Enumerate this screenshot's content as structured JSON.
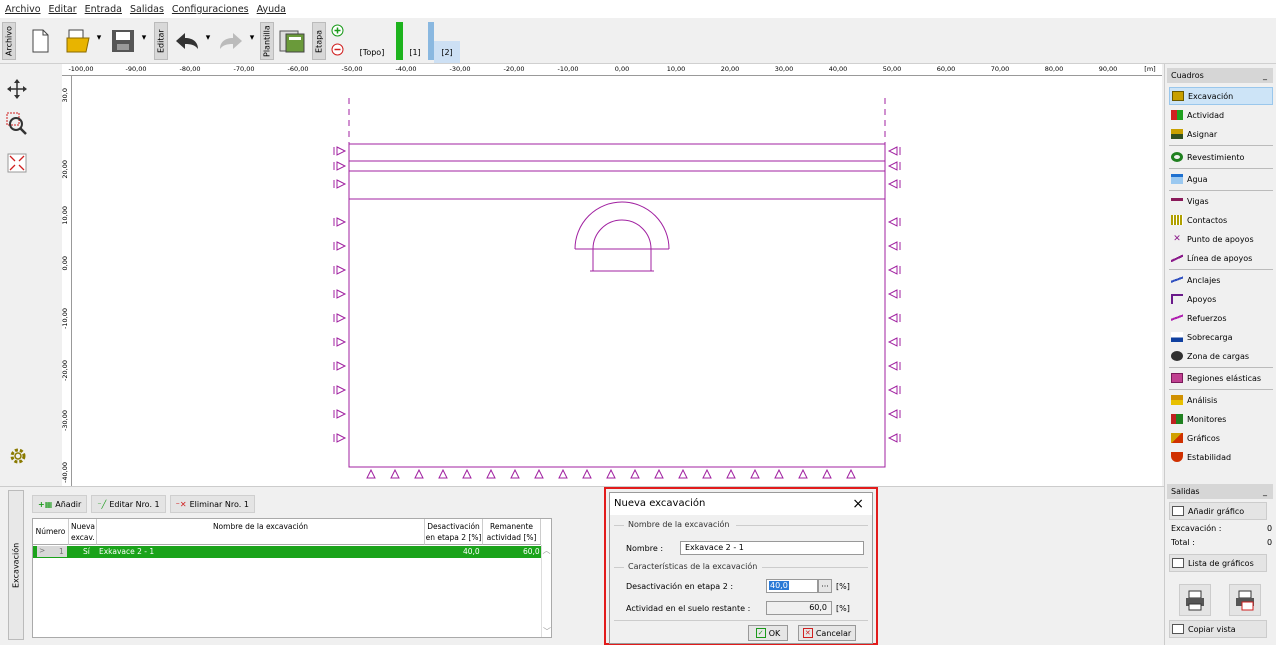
{
  "menu": [
    "Archivo",
    "Editar",
    "Entrada",
    "Salidas",
    "Configuraciones",
    "Ayuda"
  ],
  "toolbar": {
    "archivo_label": "Archivo",
    "editar_label": "Editar",
    "plantilla_label": "Plantilla",
    "etapa_label": "Etapa",
    "stage_topo": "[Topo]",
    "stage_1": "[1]",
    "stage_2": "[2]"
  },
  "ruler": {
    "unit": "[m]",
    "ticks": [
      "-100,00",
      "-90,00",
      "-80,00",
      "-70,00",
      "-60,00",
      "-50,00",
      "-40,00",
      "-30,00",
      "-20,00",
      "-10,00",
      "0,00",
      "10,00",
      "20,00",
      "30,00",
      "40,00",
      "50,00",
      "60,00",
      "70,00",
      "80,00",
      "90,00"
    ],
    "vticks": [
      "30,0",
      "20,00",
      "10,00",
      "0,00",
      "-10,00",
      "-20,00",
      "-30,00",
      "-40,00"
    ]
  },
  "cuadros": {
    "title": "Cuadros",
    "items": [
      {
        "label": "Excavación",
        "icon": "excavation-icon",
        "color": "#c8a000"
      },
      {
        "label": "Actividad",
        "icon": "activity-icon",
        "color": "#d02020"
      },
      {
        "label": "Asignar",
        "icon": "assign-icon",
        "color": "#a08000"
      },
      {
        "label": "Revestimiento",
        "icon": "lining-icon",
        "color": "#208020"
      },
      {
        "label": "Agua",
        "icon": "water-icon",
        "color": "#1e70d0"
      },
      {
        "label": "Vigas",
        "icon": "beams-icon",
        "color": "#8a1a5a"
      },
      {
        "label": "Contactos",
        "icon": "contacts-icon",
        "color": "#b0a000"
      },
      {
        "label": "Punto de apoyos",
        "icon": "point-support-icon",
        "color": "#8a1a8a"
      },
      {
        "label": "Línea de apoyos",
        "icon": "line-support-icon",
        "color": "#8a1a8a"
      },
      {
        "label": "Anclajes",
        "icon": "anchors-icon",
        "color": "#3050c0"
      },
      {
        "label": "Apoyos",
        "icon": "props-icon",
        "color": "#6a1a8a"
      },
      {
        "label": "Refuerzos",
        "icon": "reinforcement-icon",
        "color": "#b020b0"
      },
      {
        "label": "Sobrecarga",
        "icon": "surcharge-icon",
        "color": "#1040a0"
      },
      {
        "label": "Zona de cargas",
        "icon": "load-zone-icon",
        "color": "#303030"
      },
      {
        "label": "Regiones elásticas",
        "icon": "elastic-regions-icon",
        "color": "#c04090"
      },
      {
        "label": "Análisis",
        "icon": "analysis-icon",
        "color": "#d09000"
      },
      {
        "label": "Monitores",
        "icon": "monitors-icon",
        "color": "#c02020"
      },
      {
        "label": "Gráficos",
        "icon": "graphs-icon",
        "color": "#d0a000"
      },
      {
        "label": "Estabilidad",
        "icon": "stability-icon",
        "color": "#d03000"
      }
    ]
  },
  "salidas": {
    "title": "Salidas",
    "add_graph": "Añadir gráfico",
    "excavacion_label": "Excavación :",
    "excavacion_count": "0",
    "total_label": "Total :",
    "total_count": "0",
    "list_graphs": "Lista de gráficos",
    "copy_view": "Copiar vista"
  },
  "bottom": {
    "side_label": "Excavación",
    "add": "Añadir",
    "edit": "Editar Nro. 1",
    "delete": "Eliminar Nro. 1",
    "columns": {
      "num": "Número",
      "new": "Nueva excav.",
      "name": "Nombre de la excavación",
      "deact": "Desactivación en etapa 2 [%]",
      "rem": "Remanente actividad [%]"
    },
    "row": {
      "arrow": ">",
      "num": "1",
      "new": "Sí",
      "name": "Exkavace 2 - 1",
      "deact": "40,0",
      "rem": "60,0"
    }
  },
  "dialog": {
    "title": "Nueva excavación",
    "group1": "Nombre de la excavación",
    "name_label": "Nombre :",
    "name_value": "Exkavace 2 - 1",
    "group2": "Características de la excavación",
    "deact_label": "Desactivación en etapa 2 :",
    "deact_value": "40,0",
    "deact_unit": "[%]",
    "act_label": "Actividad en el suelo restante :",
    "act_value": "60,0",
    "act_unit": "[%]",
    "ok": "OK",
    "cancel": "Cancelar",
    "close": "×"
  },
  "colors": {
    "accent": "#1aa31a",
    "highlight": "#e21b1b",
    "model": "#a020a0"
  }
}
